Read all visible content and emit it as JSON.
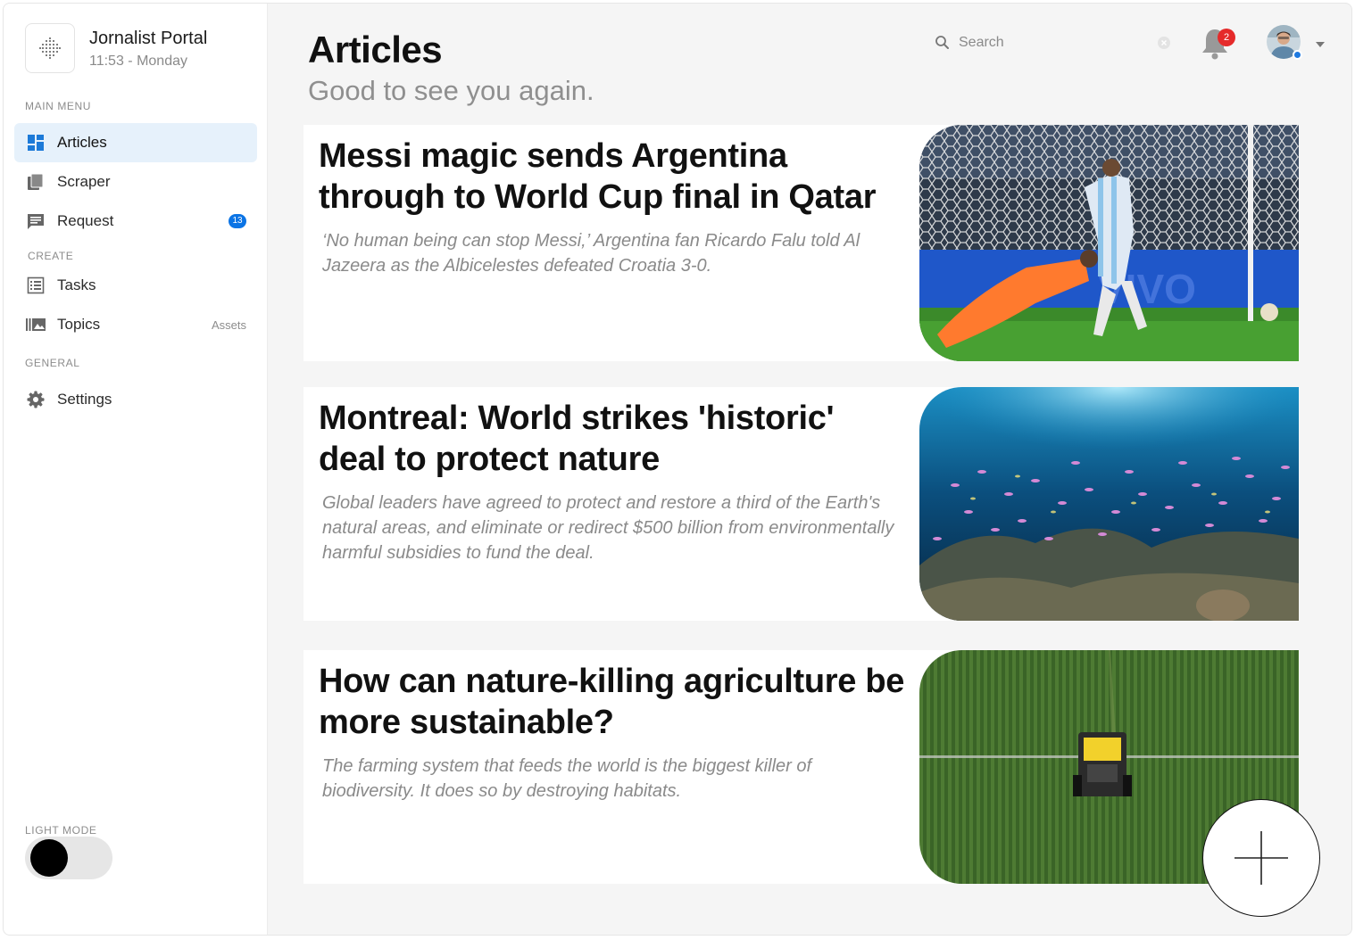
{
  "app": {
    "title": "Jornalist Portal",
    "time": "11:53 - Monday"
  },
  "sidebar": {
    "sections": {
      "main": "MAIN MENU",
      "create": "CREATE",
      "general": "GENERAL"
    },
    "items": [
      {
        "label": "Articles",
        "icon": "grid-icon",
        "active": true
      },
      {
        "label": "Scraper",
        "icon": "copy-icon"
      },
      {
        "label": "Request",
        "icon": "chat-icon",
        "badge": "13"
      },
      {
        "label": "Tasks",
        "icon": "list-icon"
      },
      {
        "label": "Topics",
        "icon": "gallery-icon",
        "aside": "Assets"
      },
      {
        "label": "Settings",
        "icon": "gear-icon"
      }
    ],
    "mode_label": "LIGHT MODE"
  },
  "header": {
    "title": "Articles",
    "subtitle": "Good to see you again.",
    "search_placeholder": "Search",
    "notification_count": "2"
  },
  "articles": [
    {
      "title": "Messi magic sends Argentina through to World Cup final in Qatar",
      "summary": "‘No human being can stop Messi,’ Argentina fan Ricardo Falu told Al Jazeera as the Albicelestes defeated Croatia 3-0.",
      "image": "football-goal-photo"
    },
    {
      "title": "Montreal: World strikes 'historic' deal to protect nature",
      "summary": "Global leaders have agreed to protect and restore a third of the Earth's natural areas, and eliminate or redirect $500 billion from environmentally harmful subsidies to fund the deal.",
      "image": "coral-reef-fish-photo"
    },
    {
      "title": "How can nature-killing agriculture be more sustainable?",
      "summary": "The farming system that feeds the world is the biggest killer of biodiversity. It does so by destroying habitats.",
      "image": "tractor-field-photo"
    }
  ],
  "colors": {
    "accent": "#0b74e5",
    "active_bg": "#e6f1fb",
    "alert": "#e52a2a"
  }
}
